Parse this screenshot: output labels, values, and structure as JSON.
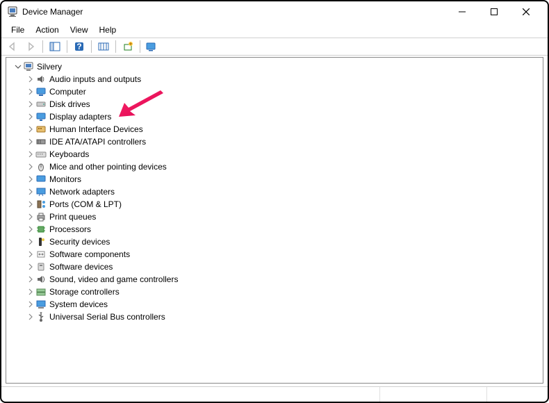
{
  "window": {
    "title": "Device Manager"
  },
  "menu": {
    "file": "File",
    "action": "Action",
    "view": "View",
    "help": "Help"
  },
  "tree": {
    "root": "Silvery",
    "items": [
      "Audio inputs and outputs",
      "Computer",
      "Disk drives",
      "Display adapters",
      "Human Interface Devices",
      "IDE ATA/ATAPI controllers",
      "Keyboards",
      "Mice and other pointing devices",
      "Monitors",
      "Network adapters",
      "Ports (COM & LPT)",
      "Print queues",
      "Processors",
      "Security devices",
      "Software components",
      "Software devices",
      "Sound, video and game controllers",
      "Storage controllers",
      "System devices",
      "Universal Serial Bus controllers"
    ]
  },
  "annotation": {
    "arrow_target_index": 3
  }
}
